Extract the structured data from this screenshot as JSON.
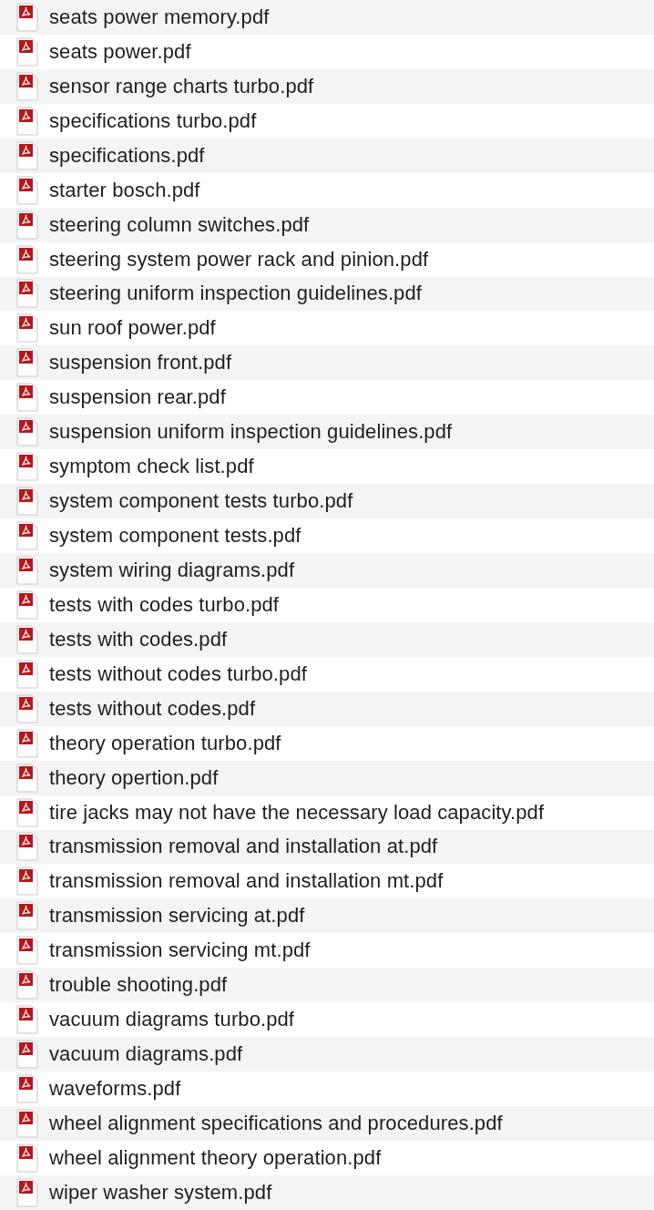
{
  "files": [
    {
      "name": "seats power memory.pdf"
    },
    {
      "name": "seats power.pdf"
    },
    {
      "name": "sensor range charts turbo.pdf"
    },
    {
      "name": "specifications turbo.pdf"
    },
    {
      "name": "specifications.pdf"
    },
    {
      "name": "starter bosch.pdf"
    },
    {
      "name": "steering column switches.pdf"
    },
    {
      "name": "steering system power rack and pinion.pdf"
    },
    {
      "name": "steering uniform inspection guidelines.pdf"
    },
    {
      "name": "sun roof power.pdf"
    },
    {
      "name": "suspension front.pdf"
    },
    {
      "name": "suspension rear.pdf"
    },
    {
      "name": "suspension uniform inspection guidelines.pdf"
    },
    {
      "name": "symptom check list.pdf"
    },
    {
      "name": "system component tests turbo.pdf"
    },
    {
      "name": "system component tests.pdf"
    },
    {
      "name": "system wiring diagrams.pdf"
    },
    {
      "name": "tests with codes turbo.pdf"
    },
    {
      "name": "tests with codes.pdf"
    },
    {
      "name": "tests without codes turbo.pdf"
    },
    {
      "name": "tests without codes.pdf"
    },
    {
      "name": "theory operation turbo.pdf"
    },
    {
      "name": "theory opertion.pdf"
    },
    {
      "name": "tire jacks may not have the necessary load capacity.pdf"
    },
    {
      "name": "transmission removal and installation at.pdf"
    },
    {
      "name": "transmission removal and installation mt.pdf"
    },
    {
      "name": "transmission servicing at.pdf"
    },
    {
      "name": "transmission servicing mt.pdf"
    },
    {
      "name": "trouble shooting.pdf"
    },
    {
      "name": "vacuum diagrams turbo.pdf"
    },
    {
      "name": "vacuum diagrams.pdf"
    },
    {
      "name": "waveforms.pdf"
    },
    {
      "name": "wheel alignment specifications and procedures.pdf"
    },
    {
      "name": "wheel alignment theory operation.pdf"
    },
    {
      "name": "wiper washer system.pdf"
    }
  ]
}
